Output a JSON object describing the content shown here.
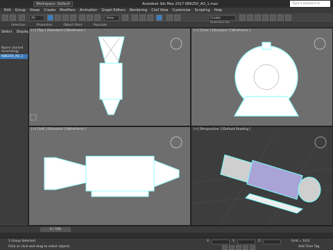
{
  "app": {
    "workspace": "Workspace: Default",
    "title": "Autodesk 3ds Max 2017    KBK250_AO_1.max",
    "search_placeholder": "Type a keyword or phrase"
  },
  "menu": [
    "Edit",
    "Group",
    "Views",
    "Create",
    "Modifiers",
    "Animation",
    "Graph Editors",
    "Rendering",
    "Civil View",
    "Customize",
    "Scripting",
    "Help"
  ],
  "toolbar": {
    "filter": "All",
    "view": "View",
    "selection_set": "Create Selection Se"
  },
  "ribbon": [
    "Selection",
    "Properties",
    "Object Paint",
    "Populate"
  ],
  "scene_explorer": {
    "tabs": [
      "Select",
      "Display"
    ],
    "rows": [
      "Name (Sorted Ascending)",
      "KBK250_AO_1"
    ]
  },
  "viewports": {
    "top": "[+] [Top ] [Standard ] [Wireframe ]",
    "front": "[+] [Front ] [Standard ] [Wireframe ]",
    "left": "[+] [Left ] [Standard ] [Wireframe ]",
    "persp": "[+] [Perspective ] [Default Shading ]"
  },
  "timeline": {
    "frame": "0 / 100"
  },
  "status": {
    "selection": "1 Group Selected",
    "prompt": "Click or click-and-drag to select objects",
    "grid": "Grid = 10,0",
    "add_time_tag": "Add Time Tag",
    "x_label": "X:",
    "y_label": "Y:",
    "z_label": "Z:"
  }
}
